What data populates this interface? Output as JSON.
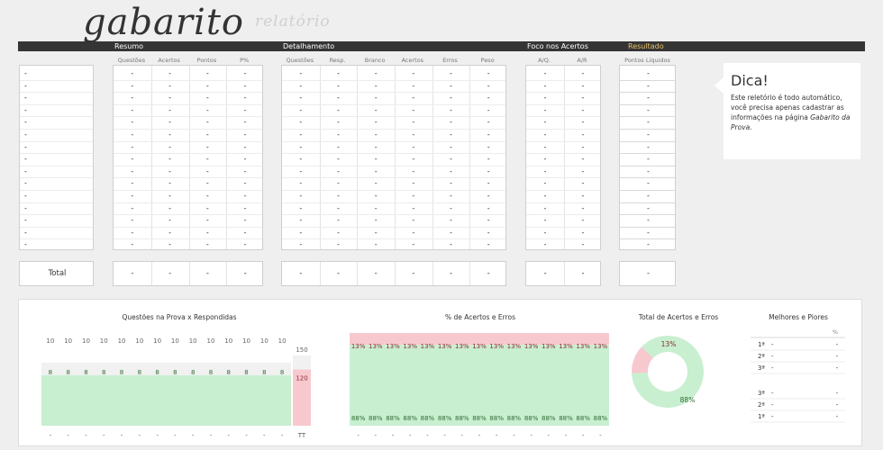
{
  "logo": {
    "title": "gabarito",
    "subtitle": "relatório"
  },
  "sections": {
    "resumo": "Resumo",
    "detalhamento": "Detalhamento",
    "foco": "Foco nos Acertos",
    "resultado": "Resultado"
  },
  "columns": {
    "resumo": [
      "Questões",
      "Acertos",
      "Pontos",
      "P%"
    ],
    "detalhamento": [
      "Questões",
      "Resp.",
      "Branco",
      "Acertos",
      "Erros",
      "Peso"
    ],
    "foco": [
      "A/Q.",
      "A/R"
    ],
    "resultado": [
      "Pontos Líquidos"
    ]
  },
  "row_count": 15,
  "empty_value": "-",
  "total_label": "Total",
  "tip": {
    "title": "Dica!",
    "line1": "Este reletório é todo automático, você precisa apenas cadastrar as informações na página",
    "line2": "Gabarito da Prova."
  },
  "charts": {
    "c1_title": "Questões na Prova x Respondidas",
    "c2_title": "% de Acertos e Erros",
    "c3_title": "Total de Acertos e Erros",
    "c4_title": "Melhores e Piores",
    "c4_pct_header": "%",
    "c4_best": [
      {
        "rank": "1ª",
        "name": "-",
        "value": "-"
      },
      {
        "rank": "2ª",
        "name": "-",
        "value": "-"
      },
      {
        "rank": "3ª",
        "name": "-",
        "value": "-"
      }
    ],
    "c4_worst": [
      {
        "rank": "3ª",
        "name": "-",
        "value": "-"
      },
      {
        "rank": "2ª",
        "name": "-",
        "value": "-"
      },
      {
        "rank": "1ª",
        "name": "-",
        "value": "-"
      }
    ]
  },
  "chart_data": [
    {
      "type": "bar",
      "title": "Questões na Prova x Respondidas",
      "categories": [
        "-",
        "-",
        "-",
        "-",
        "-",
        "-",
        "-",
        "-",
        "-",
        "-",
        "-",
        "-",
        "-",
        "-",
        "TT"
      ],
      "series": [
        {
          "values": [
            10,
            10,
            10,
            10,
            10,
            10,
            10,
            10,
            10,
            10,
            10,
            10,
            10,
            10,
            150
          ]
        },
        {
          "values": [
            8,
            8,
            8,
            8,
            8,
            8,
            8,
            8,
            8,
            8,
            8,
            8,
            8,
            8,
            120
          ]
        }
      ],
      "colors": {
        "prova": "#f1f1f1",
        "respondidas": "#c8efd0",
        "total": "#f7c9cf"
      }
    },
    {
      "type": "bar",
      "title": "% de Acertos e Erros",
      "categories": [
        "-",
        "-",
        "-",
        "-",
        "-",
        "-",
        "-",
        "-",
        "-",
        "-",
        "-",
        "-",
        "-",
        "-",
        "-"
      ],
      "series": [
        {
          "values": [
            13,
            13,
            13,
            13,
            13,
            13,
            13,
            13,
            13,
            13,
            13,
            13,
            13,
            13,
            13
          ]
        },
        {
          "values": [
            88,
            88,
            88,
            88,
            88,
            88,
            88,
            88,
            88,
            88,
            88,
            88,
            88,
            88,
            88
          ]
        }
      ],
      "labels": {
        "erros": "13%",
        "acertos": "88%"
      },
      "colors": {
        "erros": "#f7c9cf",
        "acertos": "#c8efd0"
      }
    },
    {
      "type": "pie",
      "title": "Total de Acertos e Erros",
      "values": [
        13,
        88
      ],
      "labels": [
        "13%",
        "88%"
      ],
      "colors": [
        "#f7c9cf",
        "#c8efd0"
      ]
    }
  ]
}
